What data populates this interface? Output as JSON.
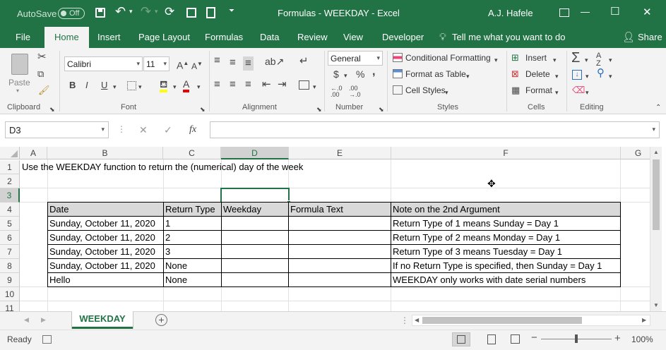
{
  "titlebar": {
    "autosave_label": "AutoSave",
    "autosave_state": "Off",
    "doc_title": "Formulas - WEEKDAY  -  Excel",
    "user": "A.J. Hafele",
    "min": "—",
    "max": "☐",
    "close": "✕"
  },
  "tabs": [
    {
      "label": "File"
    },
    {
      "label": "Home"
    },
    {
      "label": "Insert"
    },
    {
      "label": "Page Layout"
    },
    {
      "label": "Formulas"
    },
    {
      "label": "Data"
    },
    {
      "label": "Review"
    },
    {
      "label": "View"
    },
    {
      "label": "Developer"
    }
  ],
  "tellme": "Tell me what you want to do",
  "share": "Share",
  "ribbon": {
    "clipboard": {
      "paste": "Paste",
      "label": "Clipboard"
    },
    "font": {
      "name": "Calibri",
      "size": "11",
      "bold": "B",
      "italic": "I",
      "underline": "U",
      "label": "Font"
    },
    "alignment": {
      "label": "Alignment"
    },
    "number": {
      "format": "General",
      "currency": "$",
      "percent": "%",
      "comma": ",",
      "label": "Number"
    },
    "styles": {
      "conditional": "Conditional Formatting",
      "table": "Format as Table",
      "cell": "Cell Styles",
      "label": "Styles"
    },
    "cells": {
      "insert": "Insert",
      "delete": "Delete",
      "format": "Format",
      "label": "Cells"
    },
    "editing": {
      "label": "Editing"
    }
  },
  "formula_bar": {
    "name_box": "D3",
    "cancel": "✕",
    "enter": "✓",
    "fx": "fx",
    "formula": ""
  },
  "columns": [
    "A",
    "B",
    "C",
    "D",
    "E",
    "F",
    "G"
  ],
  "rows": [
    "1",
    "2",
    "3",
    "4",
    "5",
    "6",
    "7",
    "8",
    "9",
    "10",
    "11"
  ],
  "cells": {
    "a1": "Use the WEEKDAY function to return the (numerical) day of the week"
  },
  "table": {
    "headers": [
      "Date",
      "Return Type",
      "Weekday",
      "Formula Text",
      "Note on the 2nd Argument"
    ],
    "rows": [
      [
        "Sunday, October 11, 2020",
        "1",
        "",
        "",
        "Return Type of 1 means Sunday = Day 1"
      ],
      [
        "Sunday, October 11, 2020",
        "2",
        "",
        "",
        "Return Type of 2 means Monday = Day 1"
      ],
      [
        "Sunday, October 11, 2020",
        "3",
        "",
        "",
        "Return Type of 3 means Tuesday = Day 1"
      ],
      [
        "Sunday, October 11, 2020",
        "None",
        "",
        "",
        "If no Return Type is specified, then Sunday = Day 1"
      ],
      [
        "Hello",
        "None",
        "",
        "",
        "WEEKDAY only works with date serial numbers"
      ]
    ]
  },
  "sheet_tab": "WEEKDAY",
  "status": {
    "ready": "Ready",
    "zoom": "100%",
    "minus": "−",
    "plus": "+"
  }
}
